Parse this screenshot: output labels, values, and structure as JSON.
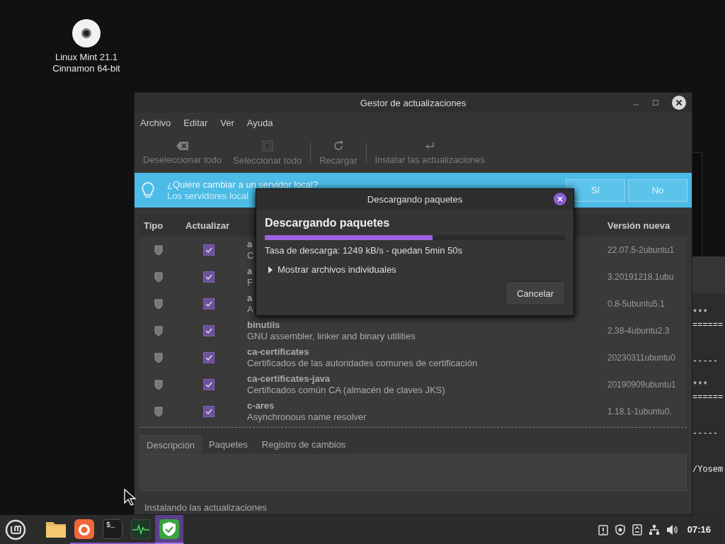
{
  "desktop_icon": {
    "lines": [
      "Linux Mint 21.1",
      "Cinnamon 64-bit"
    ]
  },
  "terminal": {
    "lines": [
      "***",
      "======",
      "-----",
      "***",
      "======",
      "-----",
      "/Yosem"
    ]
  },
  "window": {
    "title": "Gestor de actualizaciones"
  },
  "menu": [
    "Archivo",
    "Editar",
    "Ver",
    "Ayuda"
  ],
  "toolbar": [
    {
      "kind": "deselect",
      "label": "Deseleccionar todo",
      "disabled": true
    },
    {
      "kind": "select",
      "label": "Seleccionar todo",
      "disabled": true
    },
    {
      "kind": "reload",
      "label": "Recargar",
      "disabled": true
    },
    {
      "kind": "install",
      "label": "Instalar las actualizaciones",
      "disabled": true
    }
  ],
  "banner": {
    "title": "¿Quiere cambiar a un servidor local?",
    "text": "Los servidores local",
    "buttons": [
      "Sí",
      "No"
    ]
  },
  "table": {
    "columns": [
      "Tipo",
      "Actualizar",
      "Versión nueva"
    ],
    "rows": [
      {
        "name": "a",
        "description": "C",
        "version": "22.07.5-2ubuntu1",
        "checked": true
      },
      {
        "name": "a",
        "description": "F",
        "version": "3.20191218.1ubu",
        "checked": true
      },
      {
        "name": "a",
        "description": "A",
        "version": "0.8-5ubuntu5.1",
        "checked": true
      },
      {
        "name": "binutils",
        "description": "GNU assembler, linker and binary utilities",
        "version": "2.38-4ubuntu2.3",
        "checked": true
      },
      {
        "name": "ca-certificates",
        "description": "Certificados de las autoridades comunes de certificación",
        "version": "20230311ubuntu0",
        "checked": true
      },
      {
        "name": "ca-certificates-java",
        "description": "Certificados común CA (almacén de claves JKS)",
        "version": "20190909ubuntu1",
        "checked": true
      },
      {
        "name": "c-ares",
        "description": "Asynchronous name resolver",
        "version": "1.18.1-1ubuntu0.",
        "checked": true
      }
    ]
  },
  "tabs": [
    {
      "label": "Descripción",
      "selected": true
    },
    {
      "label": "Paquetes",
      "selected": false
    },
    {
      "label": "Registro de cambios",
      "selected": false
    }
  ],
  "status_bar": "Instalando las actualizaciones",
  "dialog": {
    "title": "Descargando paquetes",
    "heading": "Descargando paquetes",
    "level": 0.56,
    "rate": "Tasa de descarga: 1249 kB/s - quedan 5min 50s",
    "expander": {
      "label": "Mostrar archivos individuales",
      "expanded": false
    },
    "button": "Cancelar"
  },
  "taskbar": {
    "apps": [
      {
        "kind": "files",
        "running": false,
        "selected": false
      },
      {
        "kind": "browser",
        "running": true,
        "selected": false
      },
      {
        "kind": "terminal",
        "glyph": "$_",
        "running": true,
        "selected": false
      },
      {
        "kind": "monitor",
        "running": true,
        "selected": false
      },
      {
        "kind": "updater",
        "running": true,
        "selected": true
      }
    ],
    "tray": [
      {
        "kind": "alert"
      },
      {
        "kind": "shield"
      },
      {
        "kind": "updates"
      },
      {
        "kind": "network"
      },
      {
        "kind": "volume"
      }
    ],
    "clock": "07:16"
  }
}
